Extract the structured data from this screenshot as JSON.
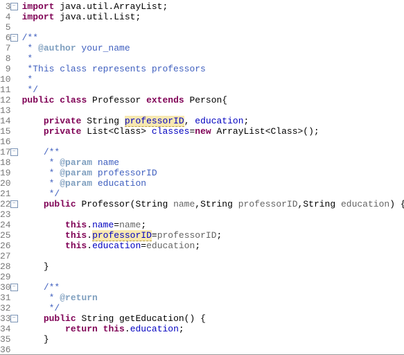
{
  "lines": {
    "3": {
      "num": "3",
      "fold": "-",
      "seg": [
        {
          "c": "kw",
          "t": "import"
        },
        {
          "c": "",
          "t": " java.util.ArrayList;"
        }
      ]
    },
    "4": {
      "num": "4",
      "seg": [
        {
          "c": "kw",
          "t": "import"
        },
        {
          "c": "",
          "t": " java.util.List;"
        }
      ]
    },
    "5": {
      "num": "5",
      "seg": [
        {
          "c": "",
          "t": ""
        }
      ]
    },
    "6": {
      "num": "6",
      "fold": "-",
      "seg": [
        {
          "c": "doc",
          "t": "/**"
        }
      ]
    },
    "7": {
      "num": "7",
      "seg": [
        {
          "c": "doc",
          "t": " * "
        },
        {
          "c": "doctag",
          "t": "@author"
        },
        {
          "c": "doc",
          "t": " your_name"
        }
      ]
    },
    "8": {
      "num": "8",
      "seg": [
        {
          "c": "doc",
          "t": " *"
        }
      ]
    },
    "9": {
      "num": "9",
      "seg": [
        {
          "c": "doc",
          "t": " *This class represents professors"
        }
      ]
    },
    "10": {
      "num": "10",
      "seg": [
        {
          "c": "doc",
          "t": " *"
        }
      ]
    },
    "11": {
      "num": "11",
      "seg": [
        {
          "c": "doc",
          "t": " */"
        }
      ]
    },
    "12": {
      "num": "12",
      "seg": [
        {
          "c": "kw",
          "t": "public"
        },
        {
          "c": "",
          "t": " "
        },
        {
          "c": "kw",
          "t": "class"
        },
        {
          "c": "",
          "t": " Professor "
        },
        {
          "c": "kw",
          "t": "extends"
        },
        {
          "c": "",
          "t": " Person{"
        }
      ]
    },
    "13": {
      "num": "13",
      "seg": [
        {
          "c": "",
          "t": ""
        }
      ]
    },
    "14": {
      "num": "14",
      "seg": [
        {
          "c": "",
          "t": "    "
        },
        {
          "c": "kw",
          "t": "private"
        },
        {
          "c": "",
          "t": " String "
        },
        {
          "c": "field warn",
          "t": "professorID"
        },
        {
          "c": "",
          "t": ", "
        },
        {
          "c": "field",
          "t": "education"
        },
        {
          "c": "",
          "t": ";"
        }
      ]
    },
    "15": {
      "num": "15",
      "seg": [
        {
          "c": "",
          "t": "    "
        },
        {
          "c": "kw",
          "t": "private"
        },
        {
          "c": "",
          "t": " List<Class> "
        },
        {
          "c": "field",
          "t": "classes"
        },
        {
          "c": "",
          "t": "="
        },
        {
          "c": "kw",
          "t": "new"
        },
        {
          "c": "",
          "t": " ArrayList<Class>();"
        }
      ]
    },
    "16": {
      "num": "16",
      "seg": [
        {
          "c": "",
          "t": ""
        }
      ]
    },
    "17": {
      "num": "17",
      "fold": "-",
      "seg": [
        {
          "c": "",
          "t": "    "
        },
        {
          "c": "doc",
          "t": "/**"
        }
      ]
    },
    "18": {
      "num": "18",
      "seg": [
        {
          "c": "",
          "t": "    "
        },
        {
          "c": "doc",
          "t": " * "
        },
        {
          "c": "doctag",
          "t": "@param"
        },
        {
          "c": "doc",
          "t": " name"
        }
      ]
    },
    "19": {
      "num": "19",
      "seg": [
        {
          "c": "",
          "t": "    "
        },
        {
          "c": "doc",
          "t": " * "
        },
        {
          "c": "doctag",
          "t": "@param"
        },
        {
          "c": "doc",
          "t": " professorID"
        }
      ]
    },
    "20": {
      "num": "20",
      "seg": [
        {
          "c": "",
          "t": "    "
        },
        {
          "c": "doc",
          "t": " * "
        },
        {
          "c": "doctag",
          "t": "@param"
        },
        {
          "c": "doc",
          "t": " education"
        }
      ]
    },
    "21": {
      "num": "21",
      "seg": [
        {
          "c": "",
          "t": "    "
        },
        {
          "c": "doc",
          "t": " */"
        }
      ]
    },
    "22": {
      "num": "22",
      "fold": "-",
      "seg": [
        {
          "c": "",
          "t": "    "
        },
        {
          "c": "kw",
          "t": "public"
        },
        {
          "c": "",
          "t": " Professor(String "
        },
        {
          "c": "ann",
          "t": "name"
        },
        {
          "c": "",
          "t": ",String "
        },
        {
          "c": "ann",
          "t": "professorID"
        },
        {
          "c": "",
          "t": ",String "
        },
        {
          "c": "ann",
          "t": "education"
        },
        {
          "c": "",
          "t": ") {"
        }
      ]
    },
    "23": {
      "num": "23",
      "seg": [
        {
          "c": "",
          "t": ""
        }
      ]
    },
    "24": {
      "num": "24",
      "seg": [
        {
          "c": "",
          "t": "        "
        },
        {
          "c": "kw",
          "t": "this"
        },
        {
          "c": "",
          "t": "."
        },
        {
          "c": "field",
          "t": "name"
        },
        {
          "c": "",
          "t": "="
        },
        {
          "c": "ann",
          "t": "name"
        },
        {
          "c": "",
          "t": ";"
        }
      ]
    },
    "25": {
      "num": "25",
      "seg": [
        {
          "c": "",
          "t": "        "
        },
        {
          "c": "kw",
          "t": "this"
        },
        {
          "c": "",
          "t": "."
        },
        {
          "c": "field warn",
          "t": "professorID"
        },
        {
          "c": "",
          "t": "="
        },
        {
          "c": "ann",
          "t": "professorID"
        },
        {
          "c": "",
          "t": ";"
        }
      ]
    },
    "26": {
      "num": "26",
      "seg": [
        {
          "c": "",
          "t": "        "
        },
        {
          "c": "kw",
          "t": "this"
        },
        {
          "c": "",
          "t": "."
        },
        {
          "c": "field",
          "t": "education"
        },
        {
          "c": "",
          "t": "="
        },
        {
          "c": "ann",
          "t": "education"
        },
        {
          "c": "",
          "t": ";"
        }
      ]
    },
    "27": {
      "num": "27",
      "seg": [
        {
          "c": "",
          "t": ""
        }
      ]
    },
    "28": {
      "num": "28",
      "seg": [
        {
          "c": "",
          "t": "    }"
        }
      ]
    },
    "29": {
      "num": "29",
      "seg": [
        {
          "c": "",
          "t": ""
        }
      ]
    },
    "30": {
      "num": "30",
      "fold": "-",
      "seg": [
        {
          "c": "",
          "t": "    "
        },
        {
          "c": "doc",
          "t": "/**"
        }
      ]
    },
    "31": {
      "num": "31",
      "seg": [
        {
          "c": "",
          "t": "    "
        },
        {
          "c": "doc",
          "t": " * "
        },
        {
          "c": "doctag",
          "t": "@return"
        }
      ]
    },
    "32": {
      "num": "32",
      "seg": [
        {
          "c": "",
          "t": "    "
        },
        {
          "c": "doc",
          "t": " */"
        }
      ]
    },
    "33": {
      "num": "33",
      "fold": "-",
      "seg": [
        {
          "c": "",
          "t": "    "
        },
        {
          "c": "kw",
          "t": "public"
        },
        {
          "c": "",
          "t": " String getEducation() {"
        }
      ]
    },
    "34": {
      "num": "34",
      "seg": [
        {
          "c": "",
          "t": "        "
        },
        {
          "c": "kw",
          "t": "return"
        },
        {
          "c": "",
          "t": " "
        },
        {
          "c": "kw",
          "t": "this"
        },
        {
          "c": "",
          "t": "."
        },
        {
          "c": "field",
          "t": "education"
        },
        {
          "c": "",
          "t": ";"
        }
      ]
    },
    "35": {
      "num": "35",
      "seg": [
        {
          "c": "",
          "t": "    }"
        }
      ]
    },
    "36": {
      "num": "36",
      "seg": [
        {
          "c": "",
          "t": ""
        }
      ]
    }
  },
  "order": [
    "3",
    "4",
    "5",
    "6",
    "7",
    "8",
    "9",
    "10",
    "11",
    "12",
    "13",
    "14",
    "15",
    "16",
    "17",
    "18",
    "19",
    "20",
    "21",
    "22",
    "23",
    "24",
    "25",
    "26",
    "27",
    "28",
    "29",
    "30",
    "31",
    "32",
    "33",
    "34",
    "35",
    "36"
  ]
}
